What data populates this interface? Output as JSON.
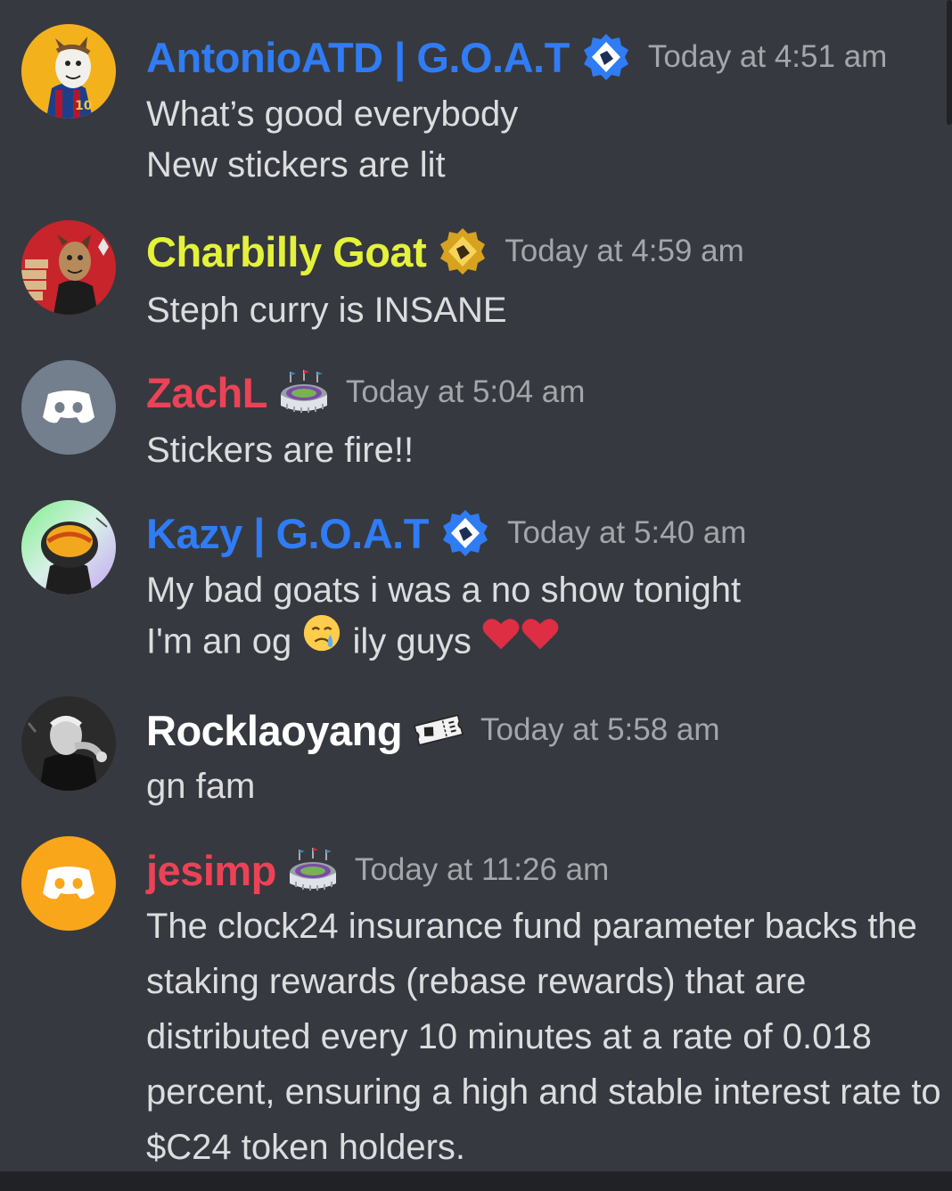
{
  "colors": {
    "background": "#36393f",
    "timestamp": "#a3a6aa",
    "message_text": "#dcddde",
    "goat_blue": "#2f7cf5",
    "goat_yellow": "#e5f23a",
    "red": "#ed4256",
    "white": "#ffffff",
    "orange": "#faa61a",
    "gray_avatar": "#747f8d"
  },
  "messages": [
    {
      "username": "AntonioATD | G.O.A.T",
      "badge_icon": "blue-verified-badge-icon",
      "timestamp": "Today at 4:51 am",
      "lines": [
        "What’s good everybody",
        "New stickers are lit"
      ]
    },
    {
      "username": "Charbilly Goat",
      "badge_icon": "gold-badge-icon",
      "timestamp": "Today at 4:59 am",
      "lines": [
        "Steph curry is INSANE"
      ]
    },
    {
      "username": "ZachL",
      "badge_icon": "stadium-icon",
      "timestamp": "Today at 5:04 am",
      "lines": [
        "Stickers are fire!!"
      ]
    },
    {
      "username": "Kazy | G.O.A.T",
      "badge_icon": "blue-verified-badge-icon",
      "timestamp": "Today at 5:40 am",
      "lines": [
        "My bad goats i was a no show tonight"
      ],
      "line2": {
        "before": "I'm an og",
        "middle": "ily guys"
      }
    },
    {
      "username": "Rocklaoyang",
      "badge_icon": "ticket-icon",
      "timestamp": "Today at 5:58 am",
      "lines": [
        "gn fam"
      ]
    },
    {
      "username": "jesimp",
      "badge_icon": "stadium-icon",
      "timestamp": "Today at 11:26 am",
      "lines": [
        "The clock24 insurance fund parameter backs the",
        "staking rewards (rebase rewards) that are",
        "distributed every 10 minutes at a rate of 0.018",
        "percent, ensuring a high and stable interest rate to",
        "$C24 token holders."
      ]
    }
  ]
}
